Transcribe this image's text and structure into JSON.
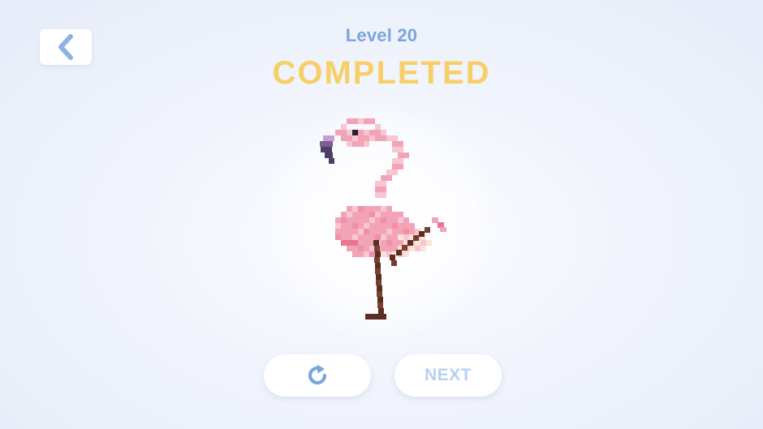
{
  "header": {
    "level_label": "Level 20",
    "status_label": "COMPLETED"
  },
  "icons": {
    "back": "chevron-left-icon",
    "replay": "replay-icon"
  },
  "artwork": {
    "subject": "flamingo",
    "palette": {
      "light_pink": "#f7c6d2",
      "pink": "#f2a3b8",
      "mid_pink": "#ef8fa8",
      "deep_pink": "#e87593",
      "cream": "#fbe3d6",
      "beak_dark": "#4d4066",
      "beak_mid": "#7e5d93",
      "beak_tip": "#c89ed0",
      "eye": "#2b2130",
      "leg": "#7a3f2e",
      "leg_dark": "#5c2e22"
    }
  },
  "buttons": {
    "next_label": "NEXT"
  },
  "colors": {
    "level_text": "#7aa6dc",
    "completed_text": "#f7cf68",
    "next_text": "#b9cff0",
    "icon_blue": "#7aa6dc"
  }
}
